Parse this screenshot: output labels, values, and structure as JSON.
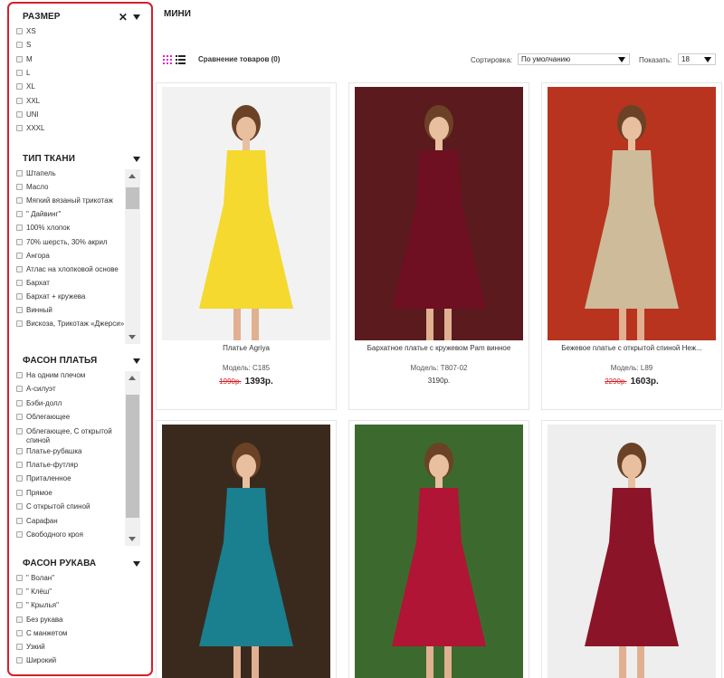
{
  "category_title": "МИНИ",
  "toolbar": {
    "compare_label": "Сравнение товаров (0)",
    "sort_label": "Сортировка:",
    "sort_value": "По умолчанию",
    "show_label": "Показать:",
    "show_value": "18"
  },
  "filters": {
    "size": {
      "title": "РАЗМЕР",
      "clear_label": "✕",
      "options": [
        "XS",
        "S",
        "M",
        "L",
        "XL",
        "XXL",
        "UNI",
        "XXXL"
      ]
    },
    "fabric": {
      "title": "ТИП ТКАНИ",
      "options": [
        "Штапель",
        "Масло",
        "Мягкий вязаный трикотаж",
        "\" Дайвинг\"",
        "100% хлопок",
        "70% шерсть, 30% акрил",
        "Ангора",
        "Атлас на хлопковой основе",
        "Бархат",
        "Бархат + кружева",
        "Винный",
        "Вискоза, Трикотаж «Джерси»"
      ]
    },
    "dress_style": {
      "title": "ФАСОН ПЛАТЬЯ",
      "options": [
        "На одним плечом",
        "А-силуэт",
        "Бэби-долл",
        "Облегающее",
        "Облегающее, С открытой спиной",
        "Платье-рубашка",
        "Платье-футляр",
        "Приталенное",
        "Прямое",
        "С открытой спиной",
        "Сарафан",
        "Свободного кроя"
      ]
    },
    "sleeve_style": {
      "title": "ФАСОН РУКАВА",
      "options": [
        "\" Волан\"",
        "\" Клёш\"",
        "\" Крылья\"",
        "Без рукава",
        "С манжетом",
        "Узкий",
        "Широкий"
      ]
    }
  },
  "products": [
    {
      "name": "Платье Agriya",
      "model": "Модель: C185",
      "old_price": "1990р.",
      "price": "1393р.",
      "dress_color": "#f5d92e",
      "bg_color": "#f2f2f2"
    },
    {
      "name": "Бархатное платье с кружевом Pam винное",
      "model": "Модель: T807-02",
      "old_price": "",
      "price": "3190р.",
      "dress_color": "#6e0f22",
      "bg_color": "#5a1a1e"
    },
    {
      "name": "Бежевое платье с открытой спиной Неж...",
      "model": "Модель: L89",
      "old_price": "2290р.",
      "price": "1603р.",
      "dress_color": "#cdbb9a",
      "bg_color": "#b8341f"
    },
    {
      "name": "",
      "model": "",
      "old_price": "",
      "price": "",
      "dress_color": "#1a7f8e",
      "bg_color": "#3a2a1e"
    },
    {
      "name": "",
      "model": "",
      "old_price": "",
      "price": "",
      "dress_color": "#b01535",
      "bg_color": "#3c6a2e"
    },
    {
      "name": "",
      "model": "",
      "old_price": "",
      "price": "",
      "dress_color": "#8c1428",
      "bg_color": "#eeeeee"
    }
  ]
}
